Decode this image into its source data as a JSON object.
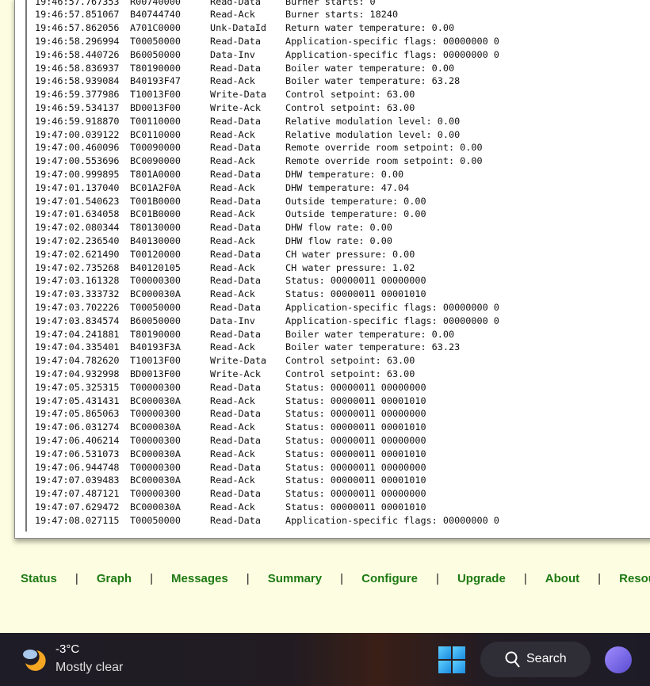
{
  "log": [
    [
      "19:46:57.767353",
      "R00740000",
      "Read-Data",
      "Burner starts: 0"
    ],
    [
      "19:46:57.851067",
      "B40744740",
      "Read-Ack",
      "Burner starts: 18240"
    ],
    [
      "19:46:57.862056",
      "A701C0000",
      "Unk-DataId",
      "Return water temperature: 0.00"
    ],
    [
      "19:46:58.296994",
      "T00050000",
      "Read-Data",
      "Application-specific flags: 00000000 0"
    ],
    [
      "19:46:58.440726",
      "B60050000",
      "Data-Inv",
      "Application-specific flags: 00000000 0"
    ],
    [
      "19:46:58.836937",
      "T80190000",
      "Read-Data",
      "Boiler water temperature: 0.00"
    ],
    [
      "19:46:58.939084",
      "B40193F47",
      "Read-Ack",
      "Boiler water temperature: 63.28"
    ],
    [
      "19:46:59.377986",
      "T10013F00",
      "Write-Data",
      "Control setpoint: 63.00"
    ],
    [
      "19:46:59.534137",
      "BD0013F00",
      "Write-Ack",
      "Control setpoint: 63.00"
    ],
    [
      "19:46:59.918870",
      "T00110000",
      "Read-Data",
      "Relative modulation level: 0.00"
    ],
    [
      "19:47:00.039122",
      "BC0110000",
      "Read-Ack",
      "Relative modulation level: 0.00"
    ],
    [
      "19:47:00.460096",
      "T00090000",
      "Read-Data",
      "Remote override room setpoint: 0.00"
    ],
    [
      "19:47:00.553696",
      "BC0090000",
      "Read-Ack",
      "Remote override room setpoint: 0.00"
    ],
    [
      "19:47:00.999895",
      "T801A0000",
      "Read-Data",
      "DHW temperature: 0.00"
    ],
    [
      "19:47:01.137040",
      "BC01A2F0A",
      "Read-Ack",
      "DHW temperature: 47.04"
    ],
    [
      "19:47:01.540623",
      "T001B0000",
      "Read-Data",
      "Outside temperature: 0.00"
    ],
    [
      "19:47:01.634058",
      "BC01B0000",
      "Read-Ack",
      "Outside temperature: 0.00"
    ],
    [
      "19:47:02.080344",
      "T80130000",
      "Read-Data",
      "DHW flow rate: 0.00"
    ],
    [
      "19:47:02.236540",
      "B40130000",
      "Read-Ack",
      "DHW flow rate: 0.00"
    ],
    [
      "19:47:02.621490",
      "T00120000",
      "Read-Data",
      "CH water pressure: 0.00"
    ],
    [
      "19:47:02.735268",
      "B40120105",
      "Read-Ack",
      "CH water pressure: 1.02"
    ],
    [
      "19:47:03.161328",
      "T00000300",
      "Read-Data",
      "Status: 00000011 00000000"
    ],
    [
      "19:47:03.333732",
      "BC000030A",
      "Read-Ack",
      "Status: 00000011 00001010"
    ],
    [
      "19:47:03.702226",
      "T00050000",
      "Read-Data",
      "Application-specific flags: 00000000 0"
    ],
    [
      "19:47:03.834574",
      "B60050000",
      "Data-Inv",
      "Application-specific flags: 00000000 0"
    ],
    [
      "19:47:04.241881",
      "T80190000",
      "Read-Data",
      "Boiler water temperature: 0.00"
    ],
    [
      "19:47:04.335401",
      "B40193F3A",
      "Read-Ack",
      "Boiler water temperature: 63.23"
    ],
    [
      "19:47:04.782620",
      "T10013F00",
      "Write-Data",
      "Control setpoint: 63.00"
    ],
    [
      "19:47:04.932998",
      "BD0013F00",
      "Write-Ack",
      "Control setpoint: 63.00"
    ],
    [
      "19:47:05.325315",
      "T00000300",
      "Read-Data",
      "Status: 00000011 00000000"
    ],
    [
      "19:47:05.431431",
      "BC000030A",
      "Read-Ack",
      "Status: 00000011 00001010"
    ],
    [
      "19:47:05.865063",
      "T00000300",
      "Read-Data",
      "Status: 00000011 00000000"
    ],
    [
      "19:47:06.031274",
      "BC000030A",
      "Read-Ack",
      "Status: 00000011 00001010"
    ],
    [
      "19:47:06.406214",
      "T00000300",
      "Read-Data",
      "Status: 00000011 00000000"
    ],
    [
      "19:47:06.531073",
      "BC000030A",
      "Read-Ack",
      "Status: 00000011 00001010"
    ],
    [
      "19:47:06.944748",
      "T00000300",
      "Read-Data",
      "Status: 00000011 00000000"
    ],
    [
      "19:47:07.039483",
      "BC000030A",
      "Read-Ack",
      "Status: 00000011 00001010"
    ],
    [
      "19:47:07.487121",
      "T00000300",
      "Read-Data",
      "Status: 00000011 00000000"
    ],
    [
      "19:47:07.629472",
      "BC000030A",
      "Read-Ack",
      "Status: 00000011 00001010"
    ],
    [
      "19:47:08.027115",
      "T00050000",
      "Read-Data",
      "Application-specific flags: 00000000 0"
    ]
  ],
  "nav": {
    "items": [
      "Status",
      "Graph",
      "Messages",
      "Summary",
      "Configure",
      "Upgrade",
      "About",
      "Resources"
    ],
    "separator": "|",
    "link_color": "#1e7a14"
  },
  "taskbar": {
    "weather": {
      "temp": "-3°C",
      "desc": "Mostly clear",
      "icon": "moon-cloud-icon"
    },
    "search_label": "Search",
    "icons": [
      "windows-start-icon",
      "search-icon",
      "meet-icon"
    ]
  }
}
